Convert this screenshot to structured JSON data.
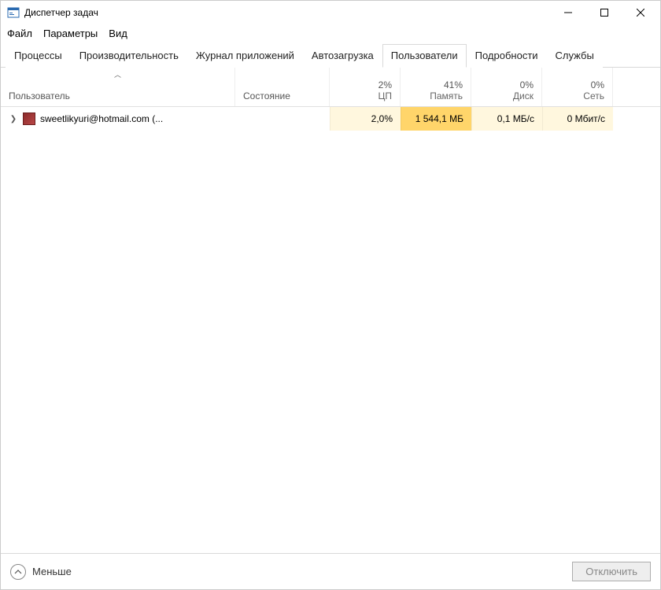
{
  "window": {
    "title": "Диспетчер задач"
  },
  "menu": {
    "file": "Файл",
    "options": "Параметры",
    "view": "Вид"
  },
  "tabs": {
    "processes": "Процессы",
    "performance": "Производительность",
    "app_history": "Журнал приложений",
    "startup": "Автозагрузка",
    "users": "Пользователи",
    "details": "Подробности",
    "services": "Службы"
  },
  "columns": {
    "user": "Пользователь",
    "state": "Состояние",
    "cpu_pct": "2%",
    "cpu_label": "ЦП",
    "mem_pct": "41%",
    "mem_label": "Память",
    "disk_pct": "0%",
    "disk_label": "Диск",
    "net_pct": "0%",
    "net_label": "Сеть"
  },
  "rows": [
    {
      "name": "sweetlikyuri@hotmail.com (...",
      "state": "",
      "cpu": "2,0%",
      "mem": "1 544,1 МБ",
      "disk": "0,1 МБ/с",
      "net": "0 Мбит/с"
    }
  ],
  "bottom": {
    "fewer": "Меньше",
    "disconnect": "Отключить"
  }
}
